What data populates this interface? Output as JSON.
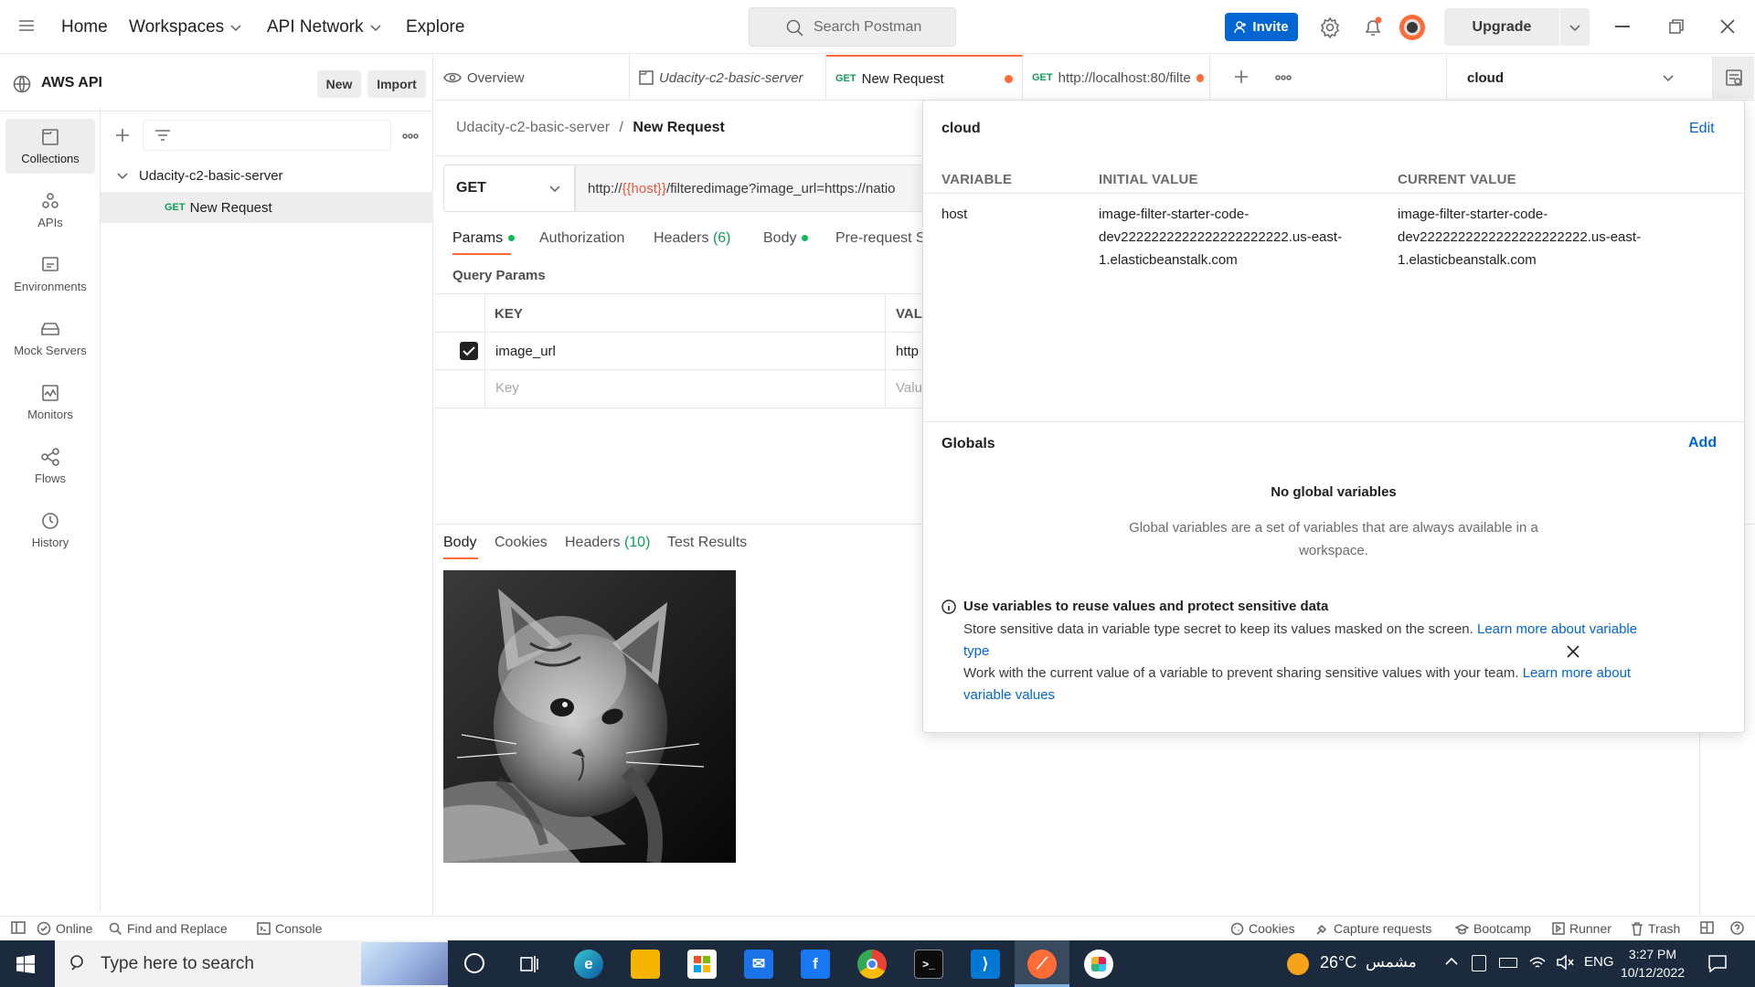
{
  "topbar": {
    "nav": [
      "Home",
      "Workspaces",
      "API Network",
      "Explore"
    ],
    "search_placeholder": "Search Postman",
    "invite_label": "Invite",
    "upgrade_label": "Upgrade"
  },
  "workspace": {
    "name": "AWS API",
    "new_label": "New",
    "import_label": "Import"
  },
  "rail": [
    {
      "label": "Collections",
      "icon": "collections-icon"
    },
    {
      "label": "APIs",
      "icon": "apis-icon"
    },
    {
      "label": "Environments",
      "icon": "environments-icon"
    },
    {
      "label": "Mock Servers",
      "icon": "mock-servers-icon"
    },
    {
      "label": "Monitors",
      "icon": "monitors-icon"
    },
    {
      "label": "Flows",
      "icon": "flows-icon"
    },
    {
      "label": "History",
      "icon": "history-icon"
    }
  ],
  "sidebar": {
    "collection": "Udacity-c2-basic-server",
    "request_method": "GET",
    "request_name": "New Request"
  },
  "tabs": [
    {
      "label": "Overview"
    },
    {
      "label": "Udacity-c2-basic-server"
    },
    {
      "method": "GET",
      "label": "New Request"
    },
    {
      "method": "GET",
      "label": "http://localhost:80/filte"
    }
  ],
  "environment": {
    "selected": "cloud"
  },
  "request": {
    "breadcrumb_collection": "Udacity-c2-basic-server",
    "breadcrumb_sep": "/",
    "breadcrumb_request": "New Request",
    "method": "GET",
    "url_prefix": "http://",
    "url_var": "{{host}}",
    "url_suffix": "/filteredimage?image_url=https://natio",
    "tabs": {
      "params": "Params",
      "authorization": "Authorization",
      "headers": "Headers",
      "headers_count": "(6)",
      "body": "Body",
      "prerequest": "Pre-request S"
    },
    "query_params_title": "Query Params",
    "col_key": "KEY",
    "col_value": "VAL",
    "row_key": "image_url",
    "row_value": "http",
    "key_placeholder": "Key",
    "value_placeholder": "Valu"
  },
  "response": {
    "tabs": {
      "body": "Body",
      "cookies": "Cookies",
      "headers": "Headers",
      "headers_count": "(10)",
      "test_results": "Test Results"
    }
  },
  "env_popover": {
    "env_name": "cloud",
    "edit_label": "Edit",
    "col_variable": "VARIABLE",
    "col_initial": "INITIAL VALUE",
    "col_current": "CURRENT VALUE",
    "var_name": "host",
    "initial_line1": "image-filter-starter-code-",
    "initial_line2": "dev2222222222222222222222.us-east-",
    "initial_line3": "1.elasticbeanstalk.com",
    "current_line1": "image-filter-starter-code-",
    "current_line2": "dev2222222222222222222222.us-east-",
    "current_line3": "1.elasticbeanstalk.com",
    "globals_title": "Globals",
    "add_label": "Add",
    "no_globals_title": "No global variables",
    "no_globals_desc_1": "Global variables are a set of variables that are always available in a",
    "no_globals_desc_2": "workspace.",
    "tip_title": "Use variables to reuse values and protect sensitive data",
    "tip_line1_text": "Store sensitive data in variable type secret to keep its values masked on the screen.",
    "tip_line1_link_a": "Learn more about variable",
    "tip_line1_link_b": "type",
    "tip_line2_text": "Work with the current value of a variable to prevent sharing sensitive values with your team.",
    "tip_line2_link_a": "Learn more about",
    "tip_line2_link_b": "variable values"
  },
  "statusbar": {
    "online": "Online",
    "find_replace": "Find and Replace",
    "console": "Console",
    "cookies": "Cookies",
    "capture": "Capture requests",
    "bootcamp": "Bootcamp",
    "runner": "Runner",
    "trash": "Trash"
  },
  "taskbar": {
    "search_placeholder": "Type here to search",
    "weather_temp": "26°C",
    "weather_label": "مشمس",
    "language": "ENG",
    "time": "3:27 PM",
    "date": "10/12/2022"
  },
  "colors": {
    "accent": "#ff6c37",
    "link": "#0265d2",
    "invite_bg": "#0265d2",
    "get_method": "#0f9d58"
  }
}
